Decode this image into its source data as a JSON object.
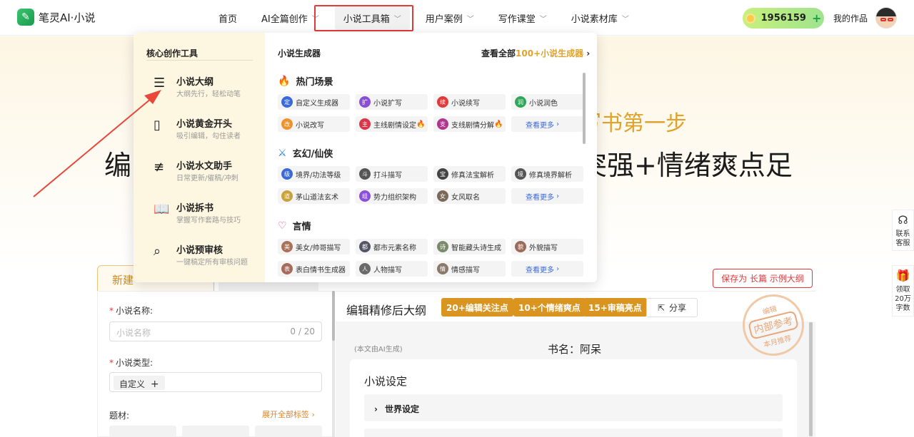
{
  "header": {
    "logo_text": "笔灵AI·小说",
    "nav": [
      "首页",
      "AI全篇创作",
      "小说工具箱",
      "用户案例",
      "写作课堂",
      "小说素材库"
    ],
    "coins": "1956159",
    "my_works": "我的作品"
  },
  "hero": {
    "sub": "写书第一步",
    "main_left": "编",
    "main_right": "突强+情绪爽点足"
  },
  "side": {
    "service": "联系客服",
    "gift": "领取20万字数"
  },
  "dropdown": {
    "left_title": "核心创作工具",
    "core_tools": [
      {
        "name": "小说大纲",
        "desc": "大纲先行，轻松动笔"
      },
      {
        "name": "小说黄金开头",
        "desc": "吸引编辑，勾住读者"
      },
      {
        "name": "小说水文助手",
        "desc": "日常更新/催稿/冲刺"
      },
      {
        "name": "小说拆书",
        "desc": "掌握写作套路与技巧"
      },
      {
        "name": "小说预审核",
        "desc": "一键稿定所有审核问题"
      }
    ],
    "right_title": "小说生成器",
    "view_all_pre": "查看全部",
    "view_all_hl": "100+小说生成器",
    "sections": [
      {
        "title": "热门场景",
        "tools": [
          "自定义生成器",
          "小说扩写",
          "小说续写",
          "小说润色",
          "小说改写",
          "主线剧情设定",
          "支线剧情分解",
          "查看更多"
        ]
      },
      {
        "title": "玄幻/仙侠",
        "tools": [
          "境界/功法等级",
          "打斗描写",
          "修真法宝解析",
          "修真境界解析",
          "茅山道法玄术",
          "势力组织架构",
          "女风取名",
          "查看更多"
        ]
      },
      {
        "title": "言情",
        "tools": [
          "美女/帅哥描写",
          "都市元素名称",
          "智能藏头诗生成",
          "外貌描写",
          "表白情书生成器",
          "人物描写",
          "情感描写",
          "查看更多"
        ]
      }
    ]
  },
  "main": {
    "tab_new": "新建",
    "save_btn": "保存为 长篇 示例大纲",
    "form": {
      "name_label": "小说名称:",
      "name_placeholder": "小说名称",
      "name_count": "0 / 20",
      "type_label": "小说类型:",
      "type_chip": "自定义",
      "theme_label": "题材:",
      "expand": "展开全部标签"
    },
    "right": {
      "title": "编辑精修后大纲",
      "badges": [
        "20+编辑关注点",
        "10+个情绪爽点",
        "15+审稿亮点"
      ],
      "share": "分享",
      "stamp_top": "编辑",
      "stamp_mid": "内部参考",
      "stamp_bot": "本月推荐",
      "ai_note": "(本文由AI生成)",
      "book_name": "书名：阿呆",
      "card_title": "小说设定",
      "world": "世界设定"
    }
  }
}
